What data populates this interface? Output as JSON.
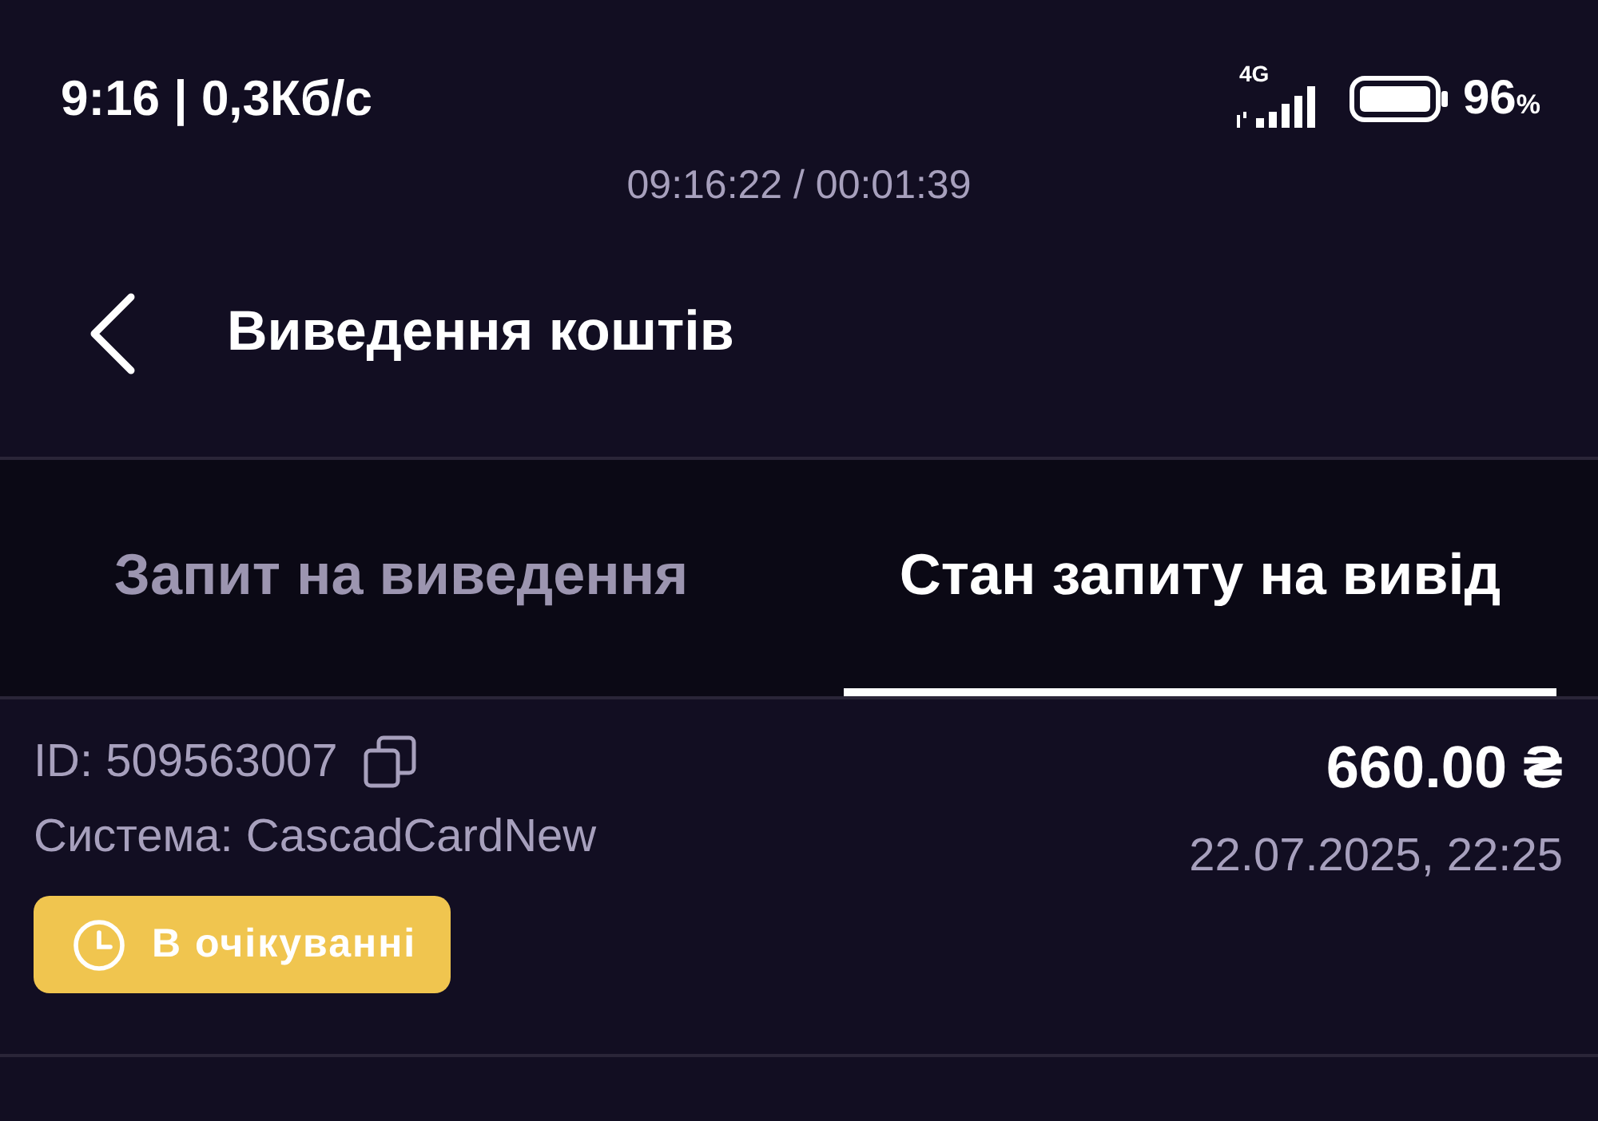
{
  "status_bar": {
    "time": "9:16 | 0,3Кб/с",
    "network": "4G",
    "battery_percent": "96",
    "battery_unit": "%"
  },
  "recording": {
    "timer": "09:16:22 / 00:01:39"
  },
  "header": {
    "title": "Виведення коштів"
  },
  "tabs": [
    {
      "label": "Запит на виведення",
      "selected": false
    },
    {
      "label": "Стан запиту на вивід",
      "selected": true
    }
  ],
  "requests": [
    {
      "id": "ID: 509563007",
      "system": "Система: CascadCardNew",
      "amount": "660.00 ₴",
      "date": "22.07.2025, 22:25",
      "status": {
        "kind": "pending",
        "label": "В очікуванні"
      }
    }
  ]
}
